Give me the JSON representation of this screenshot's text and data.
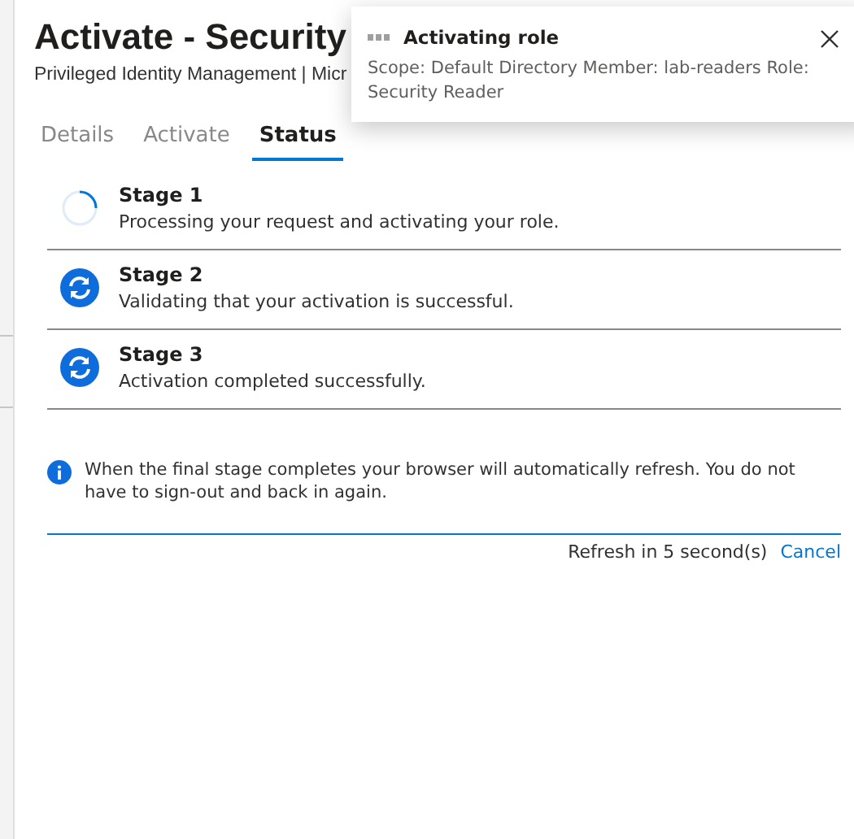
{
  "header": {
    "title": "Activate - Security",
    "subtitle": "Privileged Identity Management | Micr"
  },
  "tabs": [
    {
      "label": "Details",
      "selected": false
    },
    {
      "label": "Activate",
      "selected": false
    },
    {
      "label": "Status",
      "selected": true
    }
  ],
  "stages": [
    {
      "title": "Stage 1",
      "description": "Processing your request and activating your role.",
      "kind": "spinner"
    },
    {
      "title": "Stage 2",
      "description": "Validating that your activation is successful.",
      "kind": "sync"
    },
    {
      "title": "Stage 3",
      "description": "Activation completed successfully.",
      "kind": "sync"
    }
  ],
  "info": "When the final stage completes your browser will automatically refresh. You do not have to sign-out and back in again.",
  "footer": {
    "countdown": "Refresh in 5 second(s)",
    "cancel": "Cancel"
  },
  "notification": {
    "title": "Activating role",
    "message": "Scope: Default Directory Member: lab-readers Role: Security Reader"
  }
}
